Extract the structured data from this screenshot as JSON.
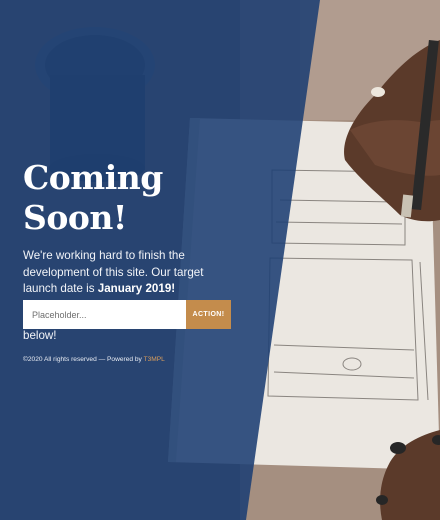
{
  "hero": {
    "title": "Coming Soon!",
    "lead_prefix": "We're working hard to finish the development of this site. Our target launch date is",
    "launch_date": "January 2019!",
    "signup_text": "Sign up for updates using the form below!"
  },
  "form": {
    "placeholder": "Placeholder...",
    "button_label": "ACTION!"
  },
  "footer": {
    "copyright": "©2020 All rights reserved — Powered by",
    "brand": "T3MPL"
  },
  "colors": {
    "overlay": "#1c3f73",
    "accent": "#c48c4c",
    "text": "#ffffff"
  }
}
